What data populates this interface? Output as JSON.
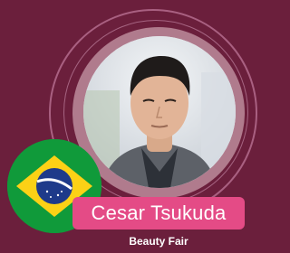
{
  "speaker": {
    "name": "Cesar Tsukuda",
    "event": "Beauty Fair",
    "country_flag_icon": "brazil-flag-icon",
    "photo": "speaker-portrait-photo"
  },
  "colors": {
    "background": "#6b1f3c",
    "ring": "#b07b8d",
    "name_pill": "#e44b86",
    "flag_green": "#109a3a",
    "flag_yellow": "#fcd116",
    "flag_blue": "#1e3a8a"
  }
}
